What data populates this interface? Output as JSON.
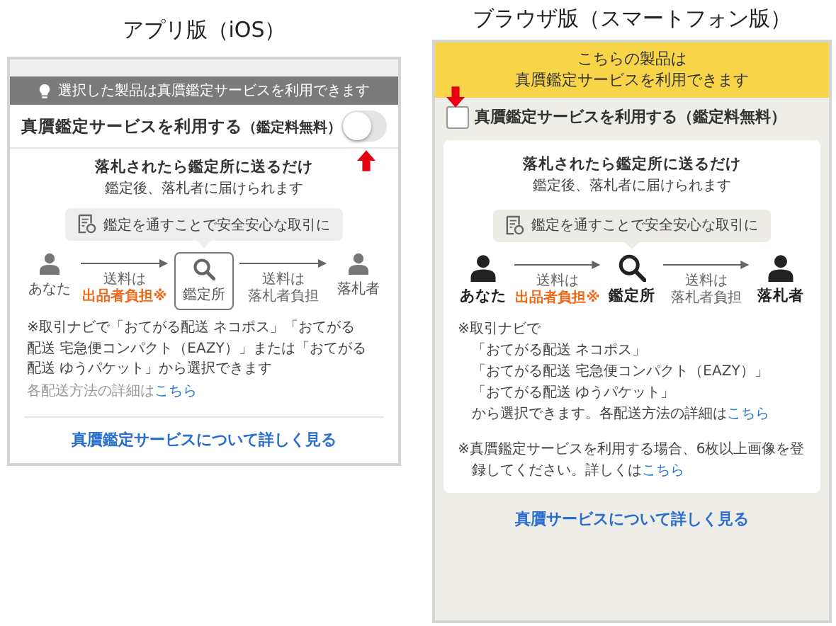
{
  "panels": [
    {
      "kind": "app",
      "heading": "アプリ版（iOS）",
      "banner": [
        "選択した製品は真贋鑑定サービスを利用できます"
      ],
      "option": {
        "label": "真贋鑑定サービスを利用する",
        "note": "（鑑定料無料）",
        "checked": false
      },
      "info": {
        "title": "落札されたら鑑定所に送るだけ",
        "subtitle": "鑑定後、落札者に届けられます",
        "callout": "鑑定を通すことで安全安心な取引に",
        "nodes": [
          "あなた",
          "鑑定所",
          "落札者"
        ],
        "edges": [
          {
            "lines": [
              "送料は",
              "出品者負担※"
            ],
            "highlight": true
          },
          {
            "lines": [
              "送料は",
              "落札者負担"
            ],
            "highlight": false
          }
        ],
        "notes": [
          {
            "lines": [
              "※取引ナビで「おてがる配送 ネコポス」「おてがる配送 宅急便コンパクト（EAZY）」または「おてがる配送 ゆうパケット」から選択できます"
            ],
            "muted": false
          },
          {
            "lines": [
              "各配送方法の詳細は"
            ],
            "link": "こちら",
            "muted": true
          }
        ]
      },
      "more_link": "真贋鑑定サービスについて詳しく見る"
    },
    {
      "kind": "browser",
      "heading": "ブラウザ版（スマートフォン版）",
      "banner": [
        "こちらの製品は",
        "真贋鑑定サービスを利用できます"
      ],
      "option": {
        "label": "真贋鑑定サービスを利用する",
        "note": "（鑑定料無料）",
        "checked": false
      },
      "info": {
        "title": "落札されたら鑑定所に送るだけ",
        "subtitle": "鑑定後、落札者に届けられます",
        "callout": "鑑定を通すことで安全安心な取引に",
        "nodes": [
          "あなた",
          "鑑定所",
          "落札者"
        ],
        "edges": [
          {
            "lines": [
              "送料は",
              "出品者負担※"
            ],
            "highlight": true
          },
          {
            "lines": [
              "送料は",
              "落札者負担"
            ],
            "highlight": false
          }
        ],
        "notes": [
          {
            "lines": [
              "※取引ナビで",
              "「おてがる配送 ネコポス」",
              "「おてがる配送 宅急便コンパクト（EAZY）」",
              "「おてがる配送 ゆうパケット」",
              "から選択できます。各配送方法の詳細は"
            ],
            "link": "こちら",
            "muted": false
          },
          {
            "lines": [
              "※真贋鑑定サービスを利用する場合、6枚以上画像を登録してください。詳しくは"
            ],
            "link": "こちら",
            "muted": false
          }
        ]
      },
      "more_link": "真贋サービスについて詳しく見る"
    }
  ]
}
